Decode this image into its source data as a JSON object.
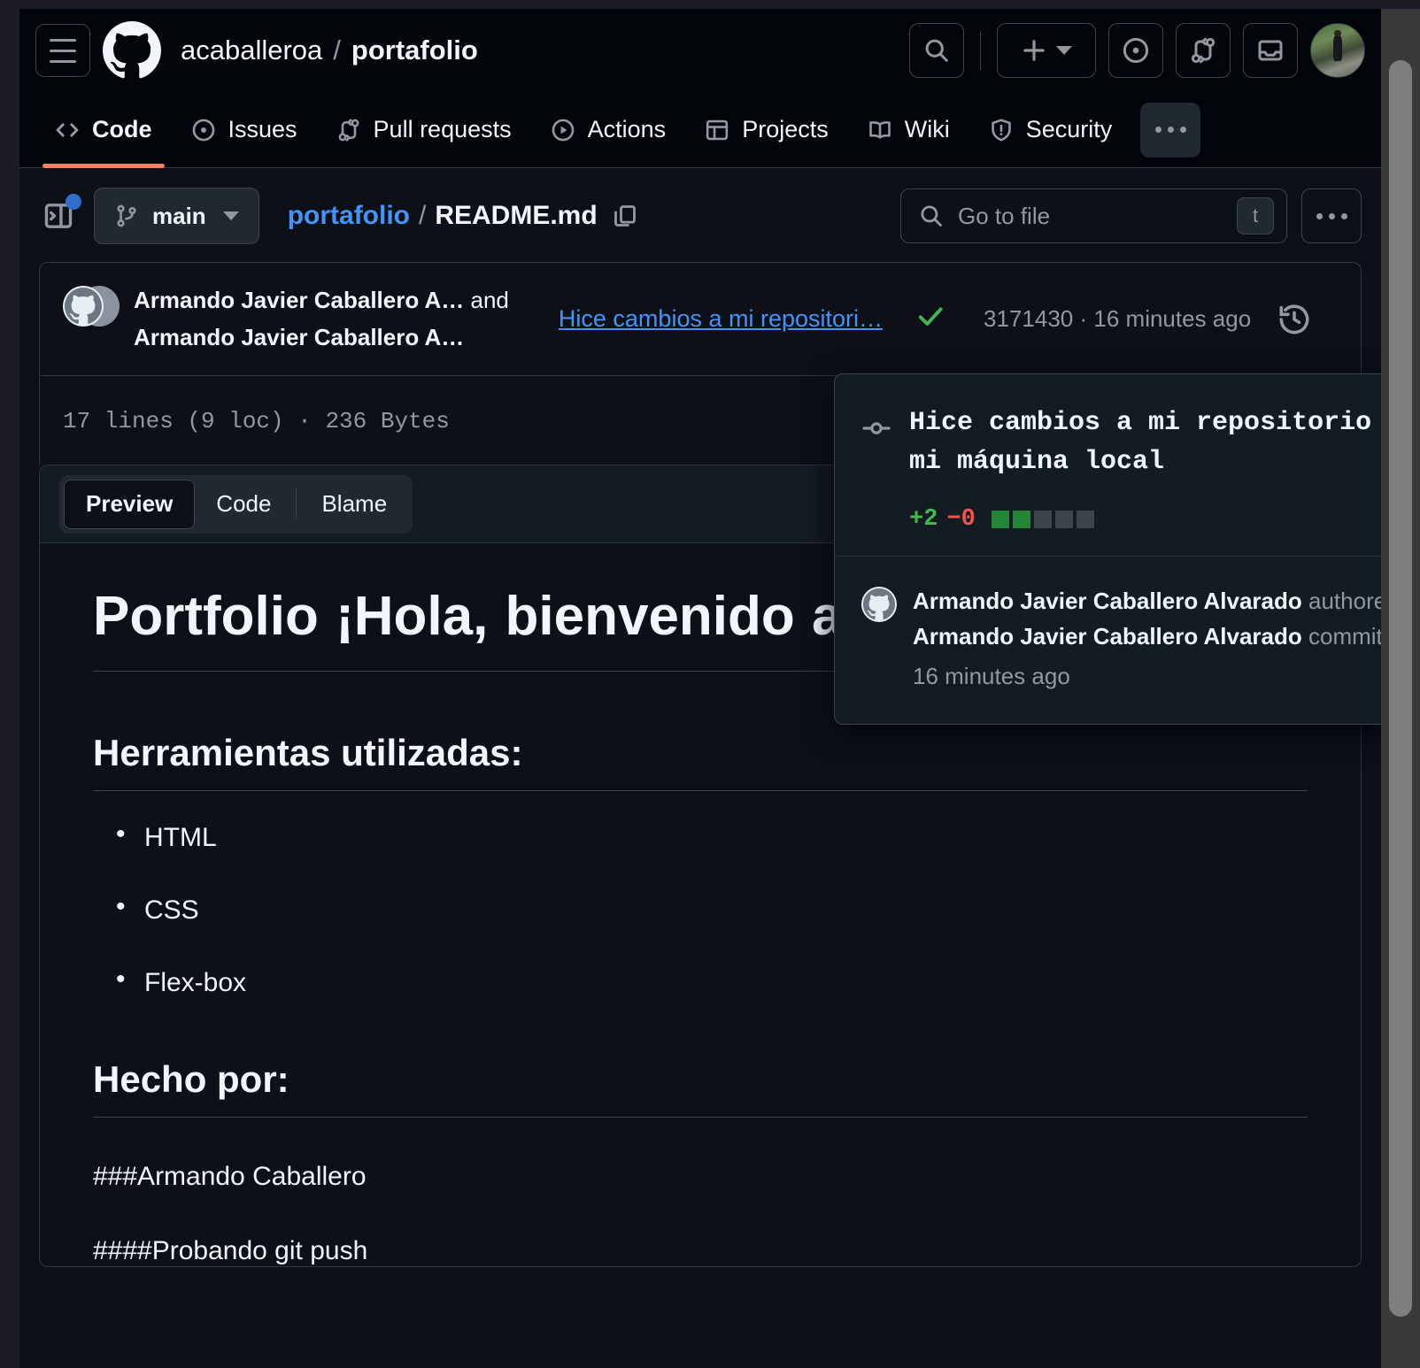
{
  "header": {
    "owner": "acaballeroa",
    "separator": "/",
    "repo": "portafolio",
    "hamburger_label": "Open global navigation menu",
    "logo_name": "github-logo",
    "actions": [
      {
        "name": "search-button",
        "icon": "search-icon"
      },
      {
        "name": "create-new-button",
        "icon": "plus-icon"
      },
      {
        "name": "issues-button",
        "icon": "issue-opened-icon"
      },
      {
        "name": "pull-requests-button",
        "icon": "git-pull-request-icon"
      },
      {
        "name": "inbox-button",
        "icon": "inbox-icon"
      },
      {
        "name": "user-avatar",
        "icon": "avatar"
      }
    ]
  },
  "repo_nav": {
    "tabs": [
      {
        "label": "Code",
        "icon": "code-icon",
        "active": true
      },
      {
        "label": "Issues",
        "icon": "issue-opened-icon",
        "active": false
      },
      {
        "label": "Pull requests",
        "icon": "git-pull-request-icon",
        "active": false
      },
      {
        "label": "Actions",
        "icon": "play-icon",
        "active": false
      },
      {
        "label": "Projects",
        "icon": "table-icon",
        "active": false
      },
      {
        "label": "Wiki",
        "icon": "book-icon",
        "active": false
      },
      {
        "label": "Security",
        "icon": "shield-icon",
        "active": false
      }
    ],
    "more_label": "More repository navigation"
  },
  "file_nav": {
    "sidebar_toggle_name": "expand-file-tree-button",
    "branch": "main",
    "breadcrumb_dir": "portafolio",
    "breadcrumb_slash": "/",
    "breadcrumb_file": "README.md",
    "copy_path_label": "Copy path",
    "search_placeholder": "Go to file",
    "search_kbd": "t",
    "more_label": "More options"
  },
  "commit": {
    "author_line_1": "Armando Javier Caballero A…",
    "author_and": "and",
    "author_line_2": "Armando Javier Caballero A…",
    "message": "Hice cambios a mi repositori…",
    "status_icon": "check-icon",
    "sha": "3171430",
    "dot": "·",
    "relative_time": "16 minutes ago",
    "history_label": "Commit history"
  },
  "popover": {
    "commit_icon": "git-commit-icon",
    "title_line_1": "Hice cambios a mi repositorio des",
    "title_line_2": "mi máquina local",
    "additions": "+2",
    "deletions": "−0",
    "diff_squares": [
      true,
      true,
      false,
      false,
      false
    ],
    "author_name": "Armando Javier Caballero Alvarado",
    "author_verb": "authored and",
    "committer_name": "Armando Javier Caballero Alvarado",
    "committer_verb": "committed",
    "relative_time": "16 minutes ago"
  },
  "file_meta": {
    "text": "17 lines (9 loc) · 236 Bytes"
  },
  "panel": {
    "tabs": [
      {
        "label": "Preview",
        "active": true
      },
      {
        "label": "Code",
        "active": false
      },
      {
        "label": "Blame",
        "active": false
      }
    ]
  },
  "readme": {
    "h1": "Portfolio ¡Hola, bienvenido a mi portafolio!",
    "h2_tools": "Herramientas utilizadas:",
    "tools": [
      "HTML",
      "CSS",
      "Flex-box"
    ],
    "h2_author": "Hecho por:",
    "p1": "###Armando Caballero",
    "p2": "####Probando git push"
  },
  "colors": {
    "page_bg": "#0d1117",
    "header_bg": "#010409",
    "border": "#30363d",
    "accent_link": "#4493f8",
    "active_tab_underline": "#f78166",
    "success_green": "#3fb950",
    "danger_red": "#f85149",
    "branch_dot": "#316dca",
    "muted_text": "#9198a1",
    "primary_text": "#f0f6fc"
  }
}
